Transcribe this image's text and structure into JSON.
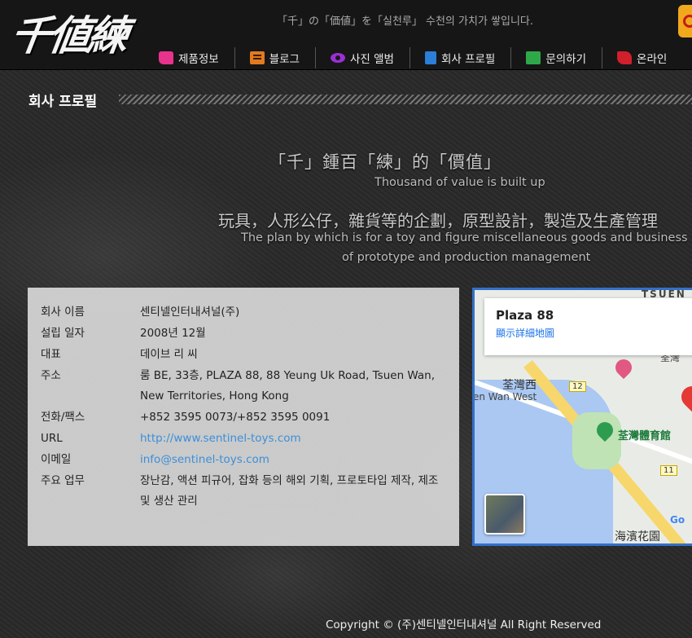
{
  "header": {
    "logo_text": "千値練",
    "slogan": "「千」の「価値」を「실천루」 수천의 가치가 쌓입니다."
  },
  "nav": {
    "items": [
      {
        "label": "제품정보",
        "icon": "thumbs-up-icon"
      },
      {
        "label": "블로그",
        "icon": "blog-icon"
      },
      {
        "label": "사진 앨범",
        "icon": "eye-icon"
      },
      {
        "label": "회사 프로필",
        "icon": "building-icon"
      },
      {
        "label": "문의하기",
        "icon": "mail-icon"
      },
      {
        "label": "온라인",
        "icon": "cart-icon"
      }
    ]
  },
  "section": {
    "title": "회사 프로필"
  },
  "taglines": {
    "cjk_1": "「千」鍾百「練」的「價值」",
    "en_1": "Thousand of value is built up",
    "cjk_2": "玩具，人形公仔，雜貨等的企劃，原型設計，製造及生產管理",
    "en_2": "The plan by which is for a toy and figure miscellaneous goods and business",
    "en_3": "of prototype and production management"
  },
  "company_info": {
    "rows": [
      {
        "label": "회사 이름",
        "value": "센티넬인터내셔널(주)"
      },
      {
        "label": "설립 일자",
        "value": "2008년 12월"
      },
      {
        "label": "대표",
        "value": "데이브 리 씨"
      },
      {
        "label": "주소",
        "value": "룸 BE, 33층, PLAZA 88, 88 Yeung Uk Road, Tsuen Wan, New Territories, Hong Kong"
      },
      {
        "label": "전화/팩스",
        "value": "+852 3595 0073/+852 3595 0091"
      },
      {
        "label": "URL",
        "value": "http://www.sentinel-toys.com"
      },
      {
        "label": "이메일",
        "value": "info@sentinel-toys.com"
      },
      {
        "label": "주요 업무",
        "value": "장난감, 액션 피규어, 잡화 등의 해외 기획, 프로토타입 제작, 제조 및 생산 관리"
      }
    ]
  },
  "map": {
    "place_name": "Plaza 88",
    "view_larger_link": "顯示詳細地圖",
    "labels": {
      "tsuen": "TSUEN",
      "tsuen_wan_west_cn": "荃灣西",
      "tsuen_wan_west_en": "en Wan West",
      "sports_centre": "荃灣體育館",
      "road_12": "12",
      "road_11": "11",
      "seaview": "海濱花園",
      "partial": "荃灣",
      "google": "Go"
    }
  },
  "footer": {
    "copyright": "Copyright © (주)센티넬인터내셔널 All Right Reserved"
  },
  "colors": {
    "header_bg": "#161616",
    "link": "#3b8fd9",
    "map_border": "#3470c8"
  }
}
